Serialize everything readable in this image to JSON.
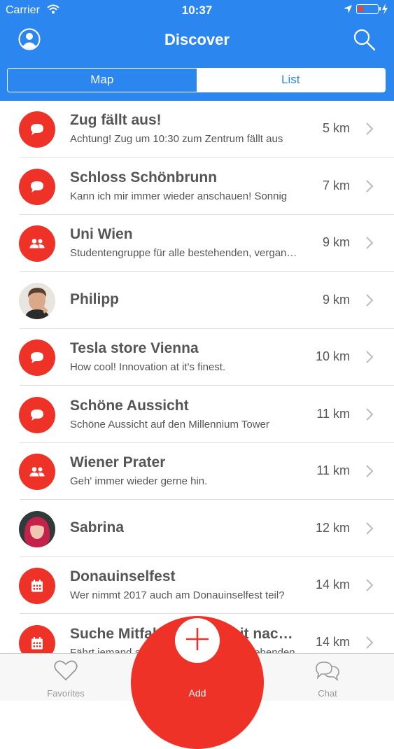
{
  "status_bar": {
    "carrier": "Carrier",
    "time": "10:37"
  },
  "nav": {
    "title": "Discover"
  },
  "segmented": {
    "options": [
      "Map",
      "List"
    ],
    "selected": "List"
  },
  "items": [
    {
      "icon": "chat-bubble-icon",
      "name": "Zug fällt aus!",
      "subtitle": "Achtung! Zug um 10:30 zum Zentrum fällt aus",
      "distance": "5 km"
    },
    {
      "icon": "chat-bubble-icon",
      "name": "Schloss Schönbrunn",
      "subtitle": "Kann ich mir immer wieder anschauen! Sonnig",
      "distance": "7 km"
    },
    {
      "icon": "group-icon",
      "name": "Uni Wien",
      "subtitle": "Studentengruppe für alle bestehenden, vergangenen",
      "distance": "9 km"
    },
    {
      "icon": "avatar-philipp",
      "name": "Philipp",
      "subtitle": "",
      "distance": "9 km"
    },
    {
      "icon": "chat-bubble-icon",
      "name": "Tesla store Vienna",
      "subtitle": "How cool! Innovation at it's finest.",
      "distance": "10 km"
    },
    {
      "icon": "chat-bubble-icon",
      "name": "Schöne Aussicht",
      "subtitle": "Schöne Aussicht auf den Millennium Tower",
      "distance": "11 km"
    },
    {
      "icon": "group-icon",
      "name": "Wiener Prater",
      "subtitle": "Geh' immer wieder gerne hin.",
      "distance": "11 km"
    },
    {
      "icon": "avatar-sabrina",
      "name": "Sabrina",
      "subtitle": "",
      "distance": "12 km"
    },
    {
      "icon": "calendar-icon",
      "name": "Donauinselfest",
      "subtitle": "Wer nimmt 2017 auch am Donauinselfest teil?",
      "distance": "14 km"
    },
    {
      "icon": "calendar-icon",
      "name": "Suche Mitfahrgelegenheit nach Graz",
      "subtitle": "Fährt jemand am Wochenende zur anstehenden",
      "distance": "14 km"
    }
  ],
  "tabbar": {
    "favorites": "Favorites",
    "add": "Add",
    "chat": "Chat"
  },
  "colors": {
    "header_blue": "#2b86f0",
    "accent_red": "#ee3228"
  }
}
